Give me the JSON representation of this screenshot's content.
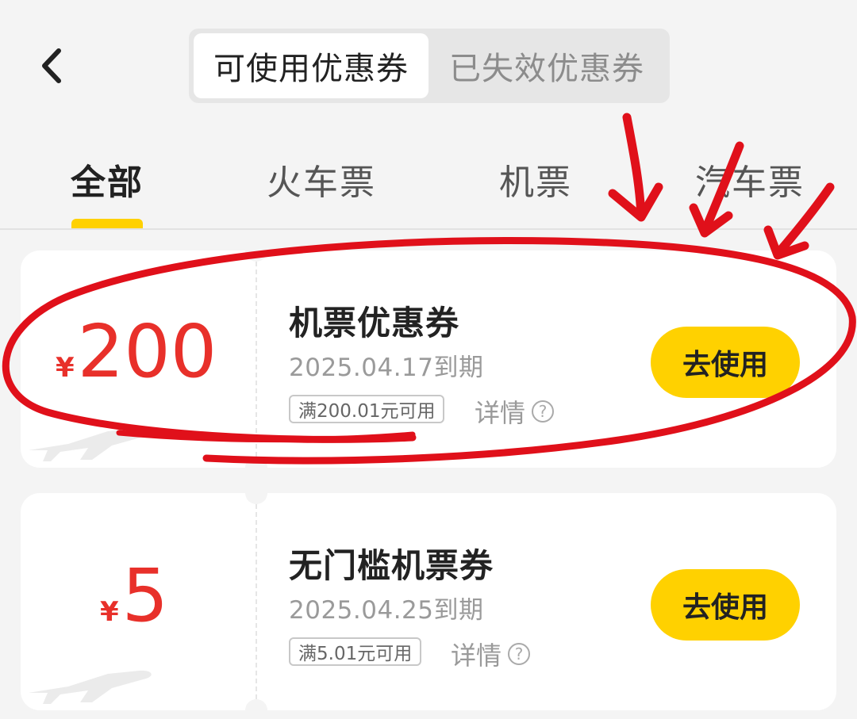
{
  "header": {
    "back_icon": "chevron-left-icon",
    "segments": [
      {
        "label": "可使用优惠券",
        "active": true
      },
      {
        "label": "已失效优惠券",
        "active": false
      }
    ]
  },
  "tabs": [
    {
      "label": "全部",
      "active": true
    },
    {
      "label": "火车票",
      "active": false
    },
    {
      "label": "机票",
      "active": false
    },
    {
      "label": "汽车票",
      "active": false
    }
  ],
  "coupons": [
    {
      "currency": "¥",
      "amount": "200",
      "title": "机票优惠券",
      "expiry": "2025.04.17到期",
      "condition": "满200.01元可用",
      "detail": "详情",
      "button": "去使用",
      "icon": "airplane-icon"
    },
    {
      "currency": "¥",
      "amount": "5",
      "title": "无门槛机票券",
      "expiry": "2025.04.25到期",
      "condition": "满5.01元可用",
      "detail": "详情",
      "button": "去使用",
      "icon": "airplane-icon"
    }
  ],
  "colors": {
    "accent_yellow": "#ffd100",
    "amount_red": "#e8302a",
    "annotation_red": "#e0101a"
  }
}
